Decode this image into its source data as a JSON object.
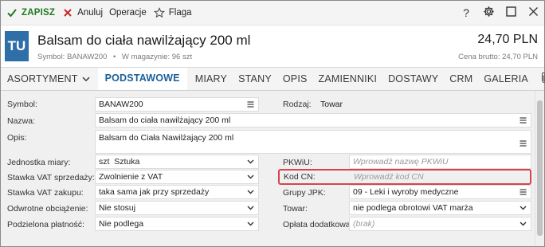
{
  "toolbar": {
    "save": "ZAPISZ",
    "cancel": "Anuluj",
    "operations": "Operacje",
    "flag": "Flaga",
    "help_icon": "question-icon",
    "settings_icon": "gear-icon",
    "maximize_icon": "maximize-icon",
    "close_icon": "close-icon"
  },
  "header": {
    "avatar": "TU",
    "title": "Balsam do ciała nawilżający 200 ml",
    "symbol_text": "Symbol: BANAW200",
    "separator": "•",
    "stock_text": "W magazynie: 96 szt",
    "price": "24,70 PLN",
    "price_label": "Cena brutto: 24,70 PLN"
  },
  "tabs": [
    {
      "label": "ASORTYMENT",
      "has_dropdown": true
    },
    {
      "label": "PODSTAWOWE",
      "active": true
    },
    {
      "label": "MIARY"
    },
    {
      "label": "STANY"
    },
    {
      "label": "OPIS"
    },
    {
      "label": "ZAMIENNIKI"
    },
    {
      "label": "DOSTAWY"
    },
    {
      "label": "CRM"
    },
    {
      "label": "GALERIA"
    }
  ],
  "tabs_attachment_icon": "paperclip-icon",
  "form": {
    "symbol": {
      "label": "Symbol:",
      "value": "BANAW200"
    },
    "rodzaj": {
      "label": "Rodzaj:",
      "value": "Towar"
    },
    "nazwa": {
      "label": "Nazwa:",
      "value": "Balsam do ciała nawilżający 200 ml"
    },
    "opis": {
      "label": "Opis:",
      "value": "Balsam do Ciała Nawilżający 200 ml"
    },
    "jednostka": {
      "label": "Jednostka miary:",
      "value": "szt  Sztuka"
    },
    "pkwiu": {
      "label": "PKWiU:",
      "placeholder": "Wprowadź nazwę PKWiU"
    },
    "vat_sprzedazy": {
      "label": "Stawka VAT sprzedaży:",
      "value": "Zwolnienie z VAT"
    },
    "kod_cn": {
      "label": "Kod CN:",
      "placeholder": "Wprowadź kod CN"
    },
    "vat_zakupu": {
      "label": "Stawka VAT zakupu:",
      "value": "taka sama jak przy sprzedaży"
    },
    "grupy_jpk": {
      "label": "Grupy JPK:",
      "value": "09 - Leki i wyroby medyczne"
    },
    "odwrotne": {
      "label": "Odwrotne obciążenie:",
      "value": "Nie stosuj"
    },
    "towar": {
      "label": "Towar:",
      "value": "nie podlega obrotowi VAT marża"
    },
    "podzielona": {
      "label": "Podzielona płatność:",
      "value": "Nie podlega"
    },
    "oplata": {
      "label": "Opłata dodatkowa:",
      "placeholder": "(brak)"
    }
  },
  "colors": {
    "save_green": "#1f7a1f",
    "cancel_red": "#c62828",
    "avatar_blue": "#2e6fa8",
    "active_tab_blue": "#1c5f98",
    "highlight_red": "#d9434b"
  }
}
